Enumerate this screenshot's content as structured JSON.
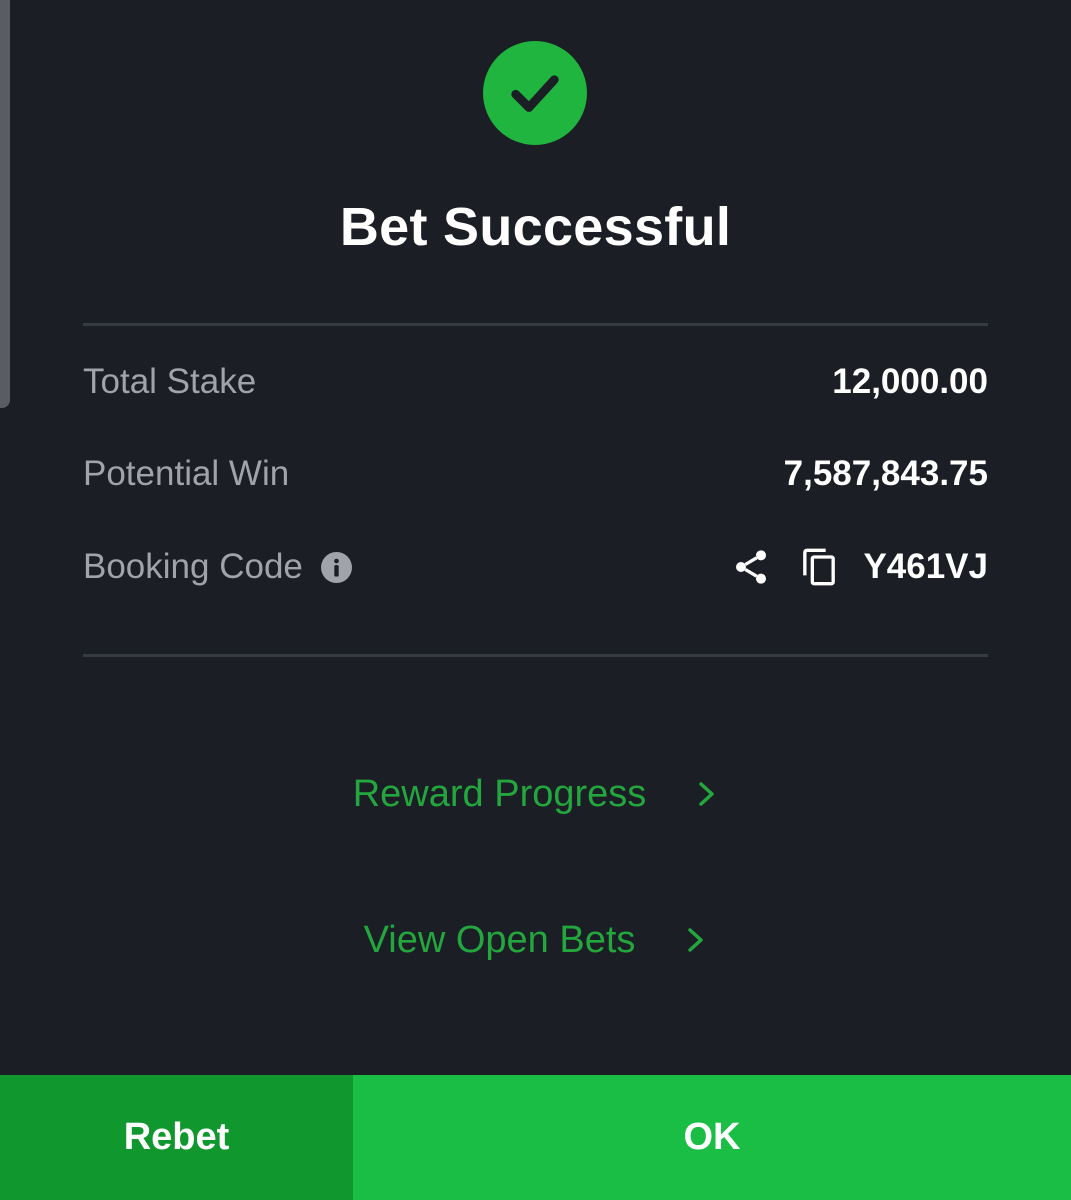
{
  "colors": {
    "background": "#1b1e25",
    "success_green": "#1fb53e",
    "link_green": "#23a63d",
    "rebet_bg": "#10982e",
    "ok_bg": "#1abe45",
    "label_gray": "#a0a3aa"
  },
  "header": {
    "icon": "check-circle-icon",
    "title": "Bet Successful"
  },
  "summary": {
    "total_stake": {
      "label": "Total Stake",
      "value": "12,000.00"
    },
    "potential_win": {
      "label": "Potential Win",
      "value": "7,587,843.75"
    },
    "booking_code": {
      "label": "Booking Code",
      "info_icon": "info-icon",
      "share_icon": "share-icon",
      "copy_icon": "copy-icon",
      "value": "Y461VJ"
    }
  },
  "links": {
    "reward_progress": "Reward Progress",
    "view_open_bets": "View Open Bets"
  },
  "footer": {
    "rebet_label": "Rebet",
    "ok_label": "OK"
  }
}
